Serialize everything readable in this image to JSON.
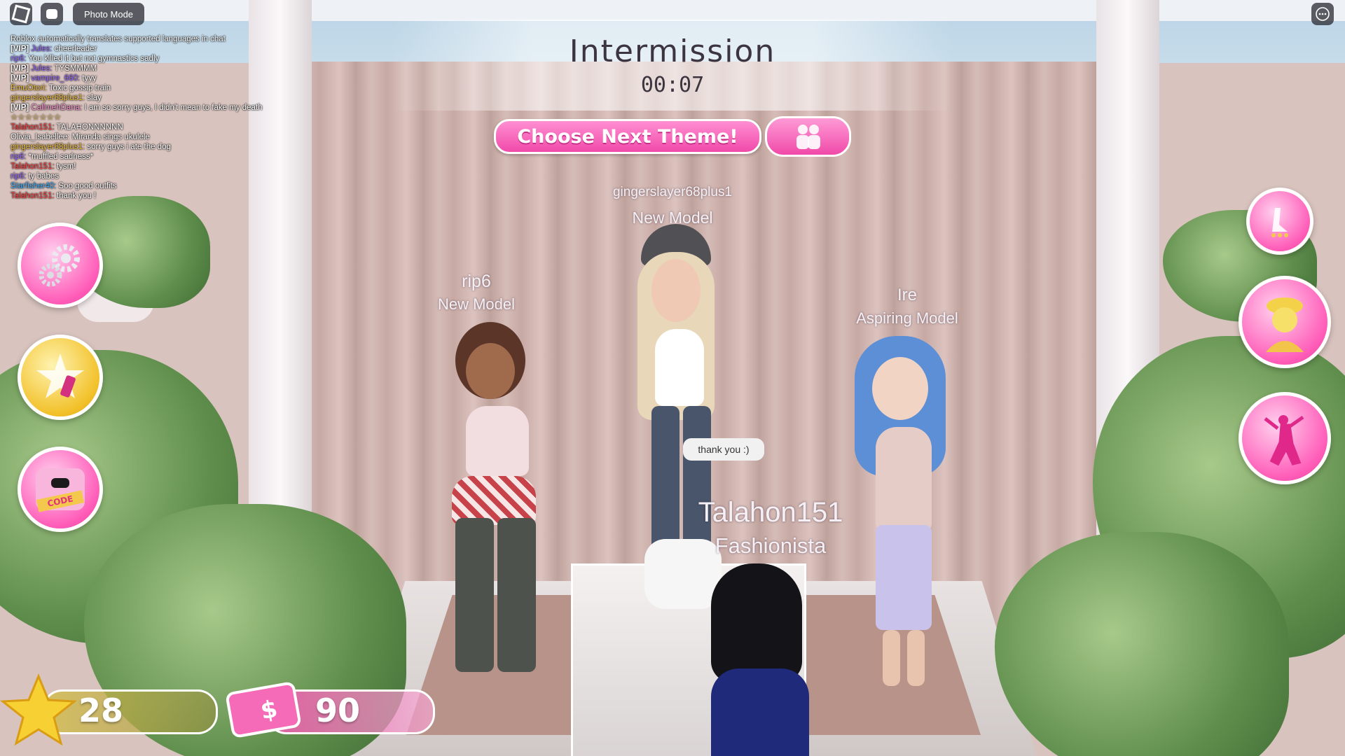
{
  "top_bar": {
    "photo_mode_label": "Photo Mode",
    "roblox_icon": "roblox-logo-icon",
    "chat_icon": "chat-icon",
    "menu_icon": "more-icon"
  },
  "chat": {
    "system_message": "Roblox automatically translates supported languages in chat",
    "messages": [
      {
        "tag": "[VIP]",
        "name": "Jules:",
        "text": "cheerleader",
        "name_color": "#9a6cff"
      },
      {
        "tag": "",
        "name": "rip6:",
        "text": "You killed it but not gymnastics sadly",
        "name_color": "#9a6cff"
      },
      {
        "tag": "[VIP]",
        "name": "Jules:",
        "text": "TYSMMMM",
        "name_color": "#9a6cff"
      },
      {
        "tag": "[VIP]",
        "name": "vampire_660:",
        "text": "tyyy",
        "name_color": "#9a6cff"
      },
      {
        "tag": "",
        "name": "EmuOtori:",
        "text": "Toxic gossip train",
        "name_color": "#f0c040"
      },
      {
        "tag": "",
        "name": "gingerslayer68plus1:",
        "text": "slay",
        "name_color": "#f0c040"
      },
      {
        "tag": "[VIP]",
        "name": "CallmehDana:",
        "text": "I am so sorry guys, I didn't mean to fake my death",
        "name_color": "#ff9ad6"
      },
      {
        "tag": "",
        "name": "",
        "text": "☆☆☆☆☆☆☆",
        "name_color": "#f0c040"
      },
      {
        "tag": "",
        "name": "Talahon151:",
        "text": "TALAHONNNNNN",
        "name_color": "#ff4040"
      },
      {
        "tag": "",
        "name": "Olivia_Isabellee:",
        "text": "Miranda sings ukulele",
        "name_color": "#ffffff"
      },
      {
        "tag": "",
        "name": "gingerslayer68plus1:",
        "text": "sorry guys i ate the dog",
        "name_color": "#f0c040"
      },
      {
        "tag": "",
        "name": "rip6:",
        "text": "*muffled sadness*",
        "name_color": "#9a6cff"
      },
      {
        "tag": "",
        "name": "Talahon151:",
        "text": "tysm!",
        "name_color": "#ff4040"
      },
      {
        "tag": "",
        "name": "rip6:",
        "text": "ty babes",
        "name_color": "#9a6cff"
      },
      {
        "tag": "",
        "name": "Starfisher40:",
        "text": "Soo good outfits",
        "name_color": "#3fb0ff"
      },
      {
        "tag": "",
        "name": "Talahon151:",
        "text": "thank you !",
        "name_color": "#ff4040"
      }
    ]
  },
  "header": {
    "title": "Intermission",
    "timer": "00:07",
    "choose_theme_label": "Choose Next Theme!",
    "friends_icon": "friends-icon"
  },
  "players": [
    {
      "name": "rip6",
      "rank": "New Model"
    },
    {
      "name": "gingerslayer68plus1",
      "rank": "New Model"
    },
    {
      "name": "Ire",
      "rank": "Aspiring Model"
    },
    {
      "name": "Talahon151",
      "rank": "Fashionista"
    }
  ],
  "speech_bubble": "thank you :)",
  "left_menu": [
    {
      "icon": "settings-icon"
    },
    {
      "icon": "shop-icon"
    },
    {
      "icon": "codes-icon",
      "label": "CODE"
    }
  ],
  "right_menu": [
    {
      "icon": "heels-icon"
    },
    {
      "icon": "character-icon"
    },
    {
      "icon": "pose-icon"
    }
  ],
  "stats": {
    "stars": "28",
    "money": "90"
  },
  "colors": {
    "accent_pink": "#f04aa9",
    "star_gold": "#f2c12a"
  }
}
